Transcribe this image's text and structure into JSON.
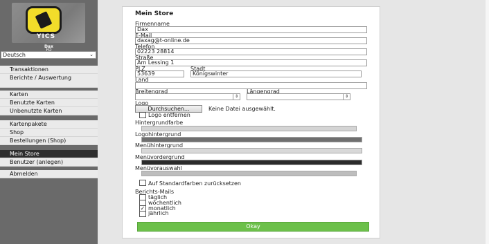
{
  "sidebar": {
    "logo_text": "YICS",
    "user_name": "Dax",
    "user_id": "FD",
    "language": "Deutsch",
    "nav_groups": [
      [
        "Transaktionen",
        "Berichte / Auswertung"
      ],
      [
        "Karten",
        "Benutzte Karten",
        "Unbenutzte Karten"
      ],
      [
        "Kartenpakete",
        "Shop",
        "Bestellungen (Shop)"
      ],
      [
        "Mein Store",
        "Benutzer (anlegen)"
      ],
      [
        "Abmelden"
      ]
    ],
    "active_item": "Mein Store"
  },
  "form": {
    "title": "Mein Store",
    "firmenname_label": "Firmenname",
    "firmenname_value": "Dax",
    "email_label": "E-Mail",
    "email_value": "daxag@t-online.de",
    "telefon_label": "Telefon",
    "telefon_value": "02223 28814",
    "strasse_label": "Straße",
    "strasse_value": "Am Lessing 1",
    "plz_label": "PLZ",
    "plz_value": "53639",
    "stadt_label": "Stadt",
    "stadt_value": "Königswinter",
    "land_label": "Land",
    "land_value": "",
    "breitengrad_label": "Breitengrad",
    "laengengrad_label": "Längengrad",
    "logo_label": "Logo",
    "browse_button": "Durchsuchen...",
    "no_file_text": "Keine Datei ausgewählt.",
    "remove_logo_label": "Logo entfernen",
    "hintergrundfarbe_label": "Hintergrundfarbe",
    "logohintergrund_label": "Logohintergrund",
    "menuehintergrund_label": "Menühintergrund",
    "menuevordergrund_label": "Menüvordergrund",
    "menueauswahl_label": "Menüvorauswahl",
    "reset_colors_label": "Auf Standardfarben zurücksetzen",
    "report_mails_label": "Berichts-Mails",
    "report_options": [
      "täglich",
      "wöchentlich",
      "monatlich",
      "jährlich"
    ],
    "report_checked": "monatlich",
    "okay_button": "Okay"
  },
  "colors": {
    "hintergrundfarbe": "#d4d4d4",
    "logohintergrund": "#6f6f6f",
    "menuehintergrund": "#d8d8d8",
    "menuevordergrund": "#2b2b2b",
    "menueauswahl": "#bdbdbd",
    "accent_green": "#6cc04a",
    "logo_yellow": "#f2dd2a"
  }
}
